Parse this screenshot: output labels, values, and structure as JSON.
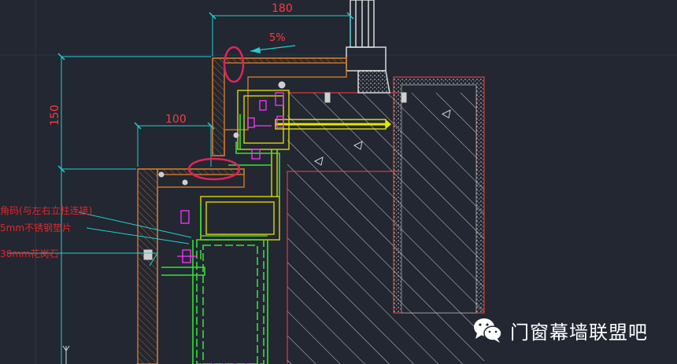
{
  "drawing": {
    "background": "#222732",
    "dimensions": {
      "top_width": "180",
      "slope": "5%",
      "height": "150",
      "inner_width": "100"
    },
    "callouts": [
      "角码(与左右立柱连接)",
      "5mm不锈钢垫片",
      "30mm花岗石"
    ],
    "colors": {
      "dimension": "#ff3b3b",
      "extension_line": "#20d0d0",
      "cladding": "#c8742a",
      "subframe": "#d8d800",
      "bracket": "#35e035",
      "bolt": "#ff33ff",
      "highlight": "#e0245a",
      "hatch": "#c9c9c9",
      "concrete_edge": "#ff4040",
      "anchor_bolt": "#e6e600"
    }
  },
  "watermark": {
    "text": "门窗幕墙联盟吧",
    "icon": "wechat-icon"
  }
}
